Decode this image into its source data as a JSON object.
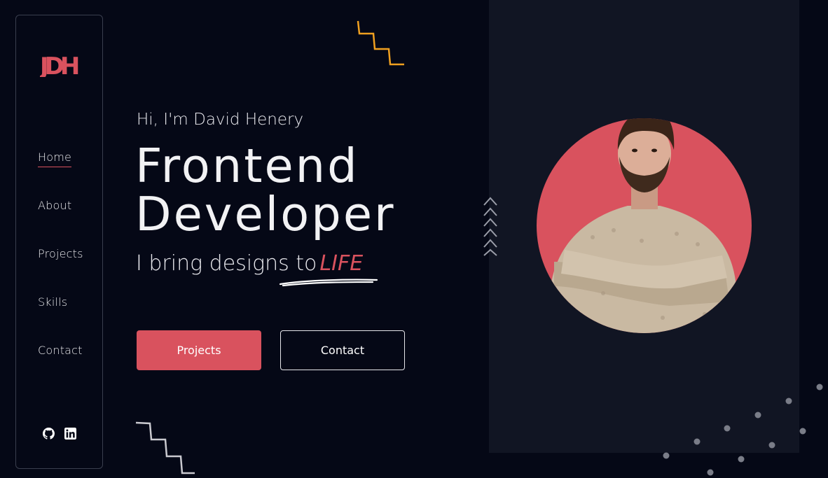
{
  "sidebar": {
    "logo_text": "JDH",
    "nav": [
      {
        "label": "Home",
        "active": true
      },
      {
        "label": "About",
        "active": false
      },
      {
        "label": "Projects",
        "active": false
      },
      {
        "label": "Skills",
        "active": false
      },
      {
        "label": "Contact",
        "active": false
      }
    ],
    "socials": [
      {
        "icon": "github-icon"
      },
      {
        "icon": "linkedin-icon"
      }
    ]
  },
  "hero": {
    "greeting": "Hi, I'm David Henery",
    "title_line1": "Frontend",
    "title_line2": "Developer",
    "tagline_prefix": "I bring designs to",
    "tagline_accent": "LIFE"
  },
  "buttons": {
    "primary_label": "Projects",
    "secondary_label": "Contact"
  },
  "colors": {
    "background": "#050816",
    "panel": "#111523",
    "accent": "#d9525e",
    "deco_orange": "#f0a020"
  }
}
